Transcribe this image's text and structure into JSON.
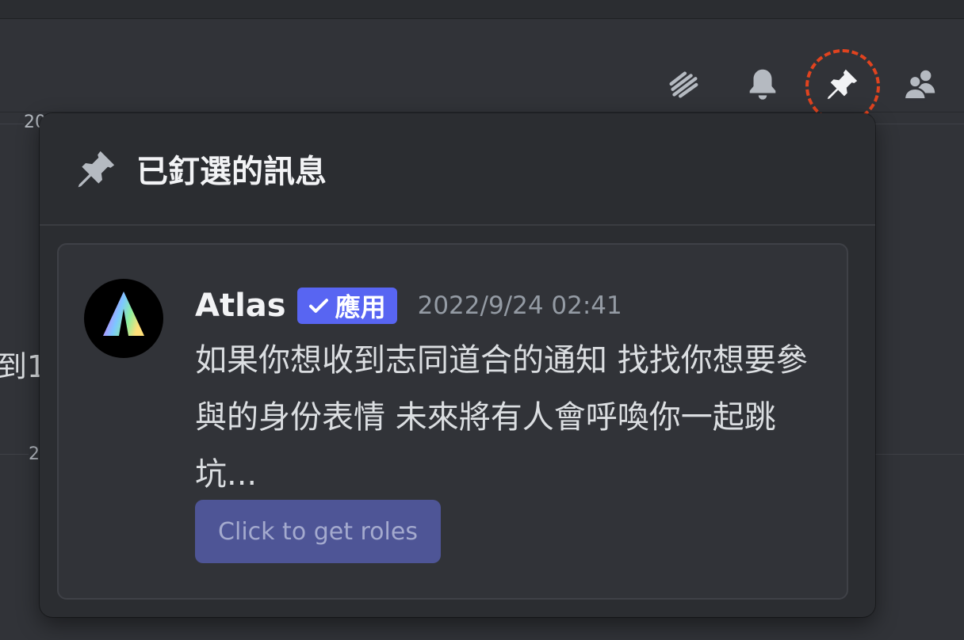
{
  "header": {
    "icons": [
      {
        "name": "threads-icon"
      },
      {
        "name": "notification-bell-icon"
      },
      {
        "name": "pin-icon"
      },
      {
        "name": "member-list-icon"
      }
    ],
    "highlight_color": "#e0431f"
  },
  "background": {
    "date_1": "20",
    "date_2": "2",
    "text_fragment": "到1"
  },
  "pins": {
    "title": "已釘選的訊息",
    "message": {
      "author": "Atlas",
      "badge": "應用",
      "timestamp": "2022/9/24 02:41",
      "content": "如果你想收到志同道合的通知 找找你想要參與的身份表情 未來將有人會呼喚你一起跳坑...",
      "button_label": "Click to get roles"
    }
  },
  "colors": {
    "badge": "#5865f2",
    "button": "#4e5596",
    "popout_bg": "#2b2d31",
    "card_bg": "#313338"
  }
}
